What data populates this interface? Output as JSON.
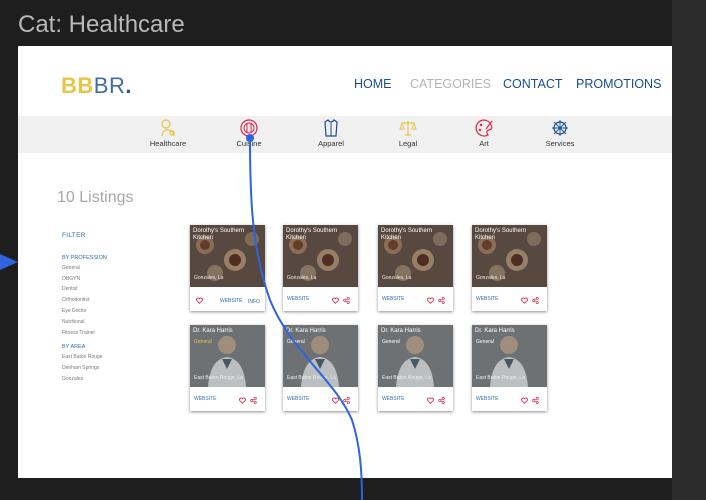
{
  "frame": {
    "title": "Cat: Healthcare"
  },
  "logo": {
    "yellow": "BB",
    "blue": "BR",
    "dot": "."
  },
  "nav": [
    {
      "label": "HOME"
    },
    {
      "label": "CATEGORIES"
    },
    {
      "label": "CONTACT"
    },
    {
      "label": "PROMOTIONS"
    }
  ],
  "categories": [
    {
      "label": "Healthcare",
      "icon": "healthcare-icon"
    },
    {
      "label": "Cuisine",
      "icon": "cuisine-icon"
    },
    {
      "label": "Apparel",
      "icon": "apparel-icon"
    },
    {
      "label": "Legal",
      "icon": "legal-icon"
    },
    {
      "label": "Art",
      "icon": "art-icon"
    },
    {
      "label": "Services",
      "icon": "services-icon"
    }
  ],
  "listings_title": "10 Listings",
  "sidebar": {
    "filter": "FILTER",
    "profession_heading": "BY PROFESSION",
    "professions": [
      "General",
      "OBGYN",
      "Dentist",
      "Orthodontist",
      "Eye Doctor",
      "Nutritional",
      "Fitness Trainer"
    ],
    "area_heading": "BY AREA",
    "areas": [
      "East Baton Rouge",
      "Denham Springs",
      "Gonzales"
    ]
  },
  "cards_row1": [
    {
      "title": "Dorothy's Southern Kitchen",
      "location": "Gonzales, La",
      "website": "WEBSITE",
      "info": "INFO"
    },
    {
      "title": "Dorothy's Southern Kitchen",
      "location": "Gonzales, La",
      "website": "WEBSITE"
    },
    {
      "title": "Dorothy's Southern Kitchen",
      "location": "Gonzales, La",
      "website": "WEBSITE"
    },
    {
      "title": "Dorothy's Southern Kitchen",
      "location": "Gonzales, La",
      "website": "WEBSITE"
    }
  ],
  "cards_row2": [
    {
      "title": "Dr. Kara Harris",
      "subtitle": "General",
      "location": "East Baton Rouge, La",
      "website": "WEBSITE"
    },
    {
      "title": "Dr. Kara Harris",
      "subtitle": "General",
      "location": "East Baton Rouge, La",
      "website": "WEBSITE"
    },
    {
      "title": "Dr. Kara Harris",
      "subtitle": "General",
      "location": "East Baton Rouge, La",
      "website": "WEBSITE"
    },
    {
      "title": "Dr. Kara Harris",
      "subtitle": "General",
      "location": "East Baton Rouge, La",
      "website": "WEBSITE"
    }
  ],
  "colors": {
    "accent_yellow": "#e8c547",
    "nav_blue": "#1a4d8f",
    "link_blue": "#2d6cb3",
    "heart_red": "#e0244a",
    "flow_blue": "#2f63e0"
  }
}
